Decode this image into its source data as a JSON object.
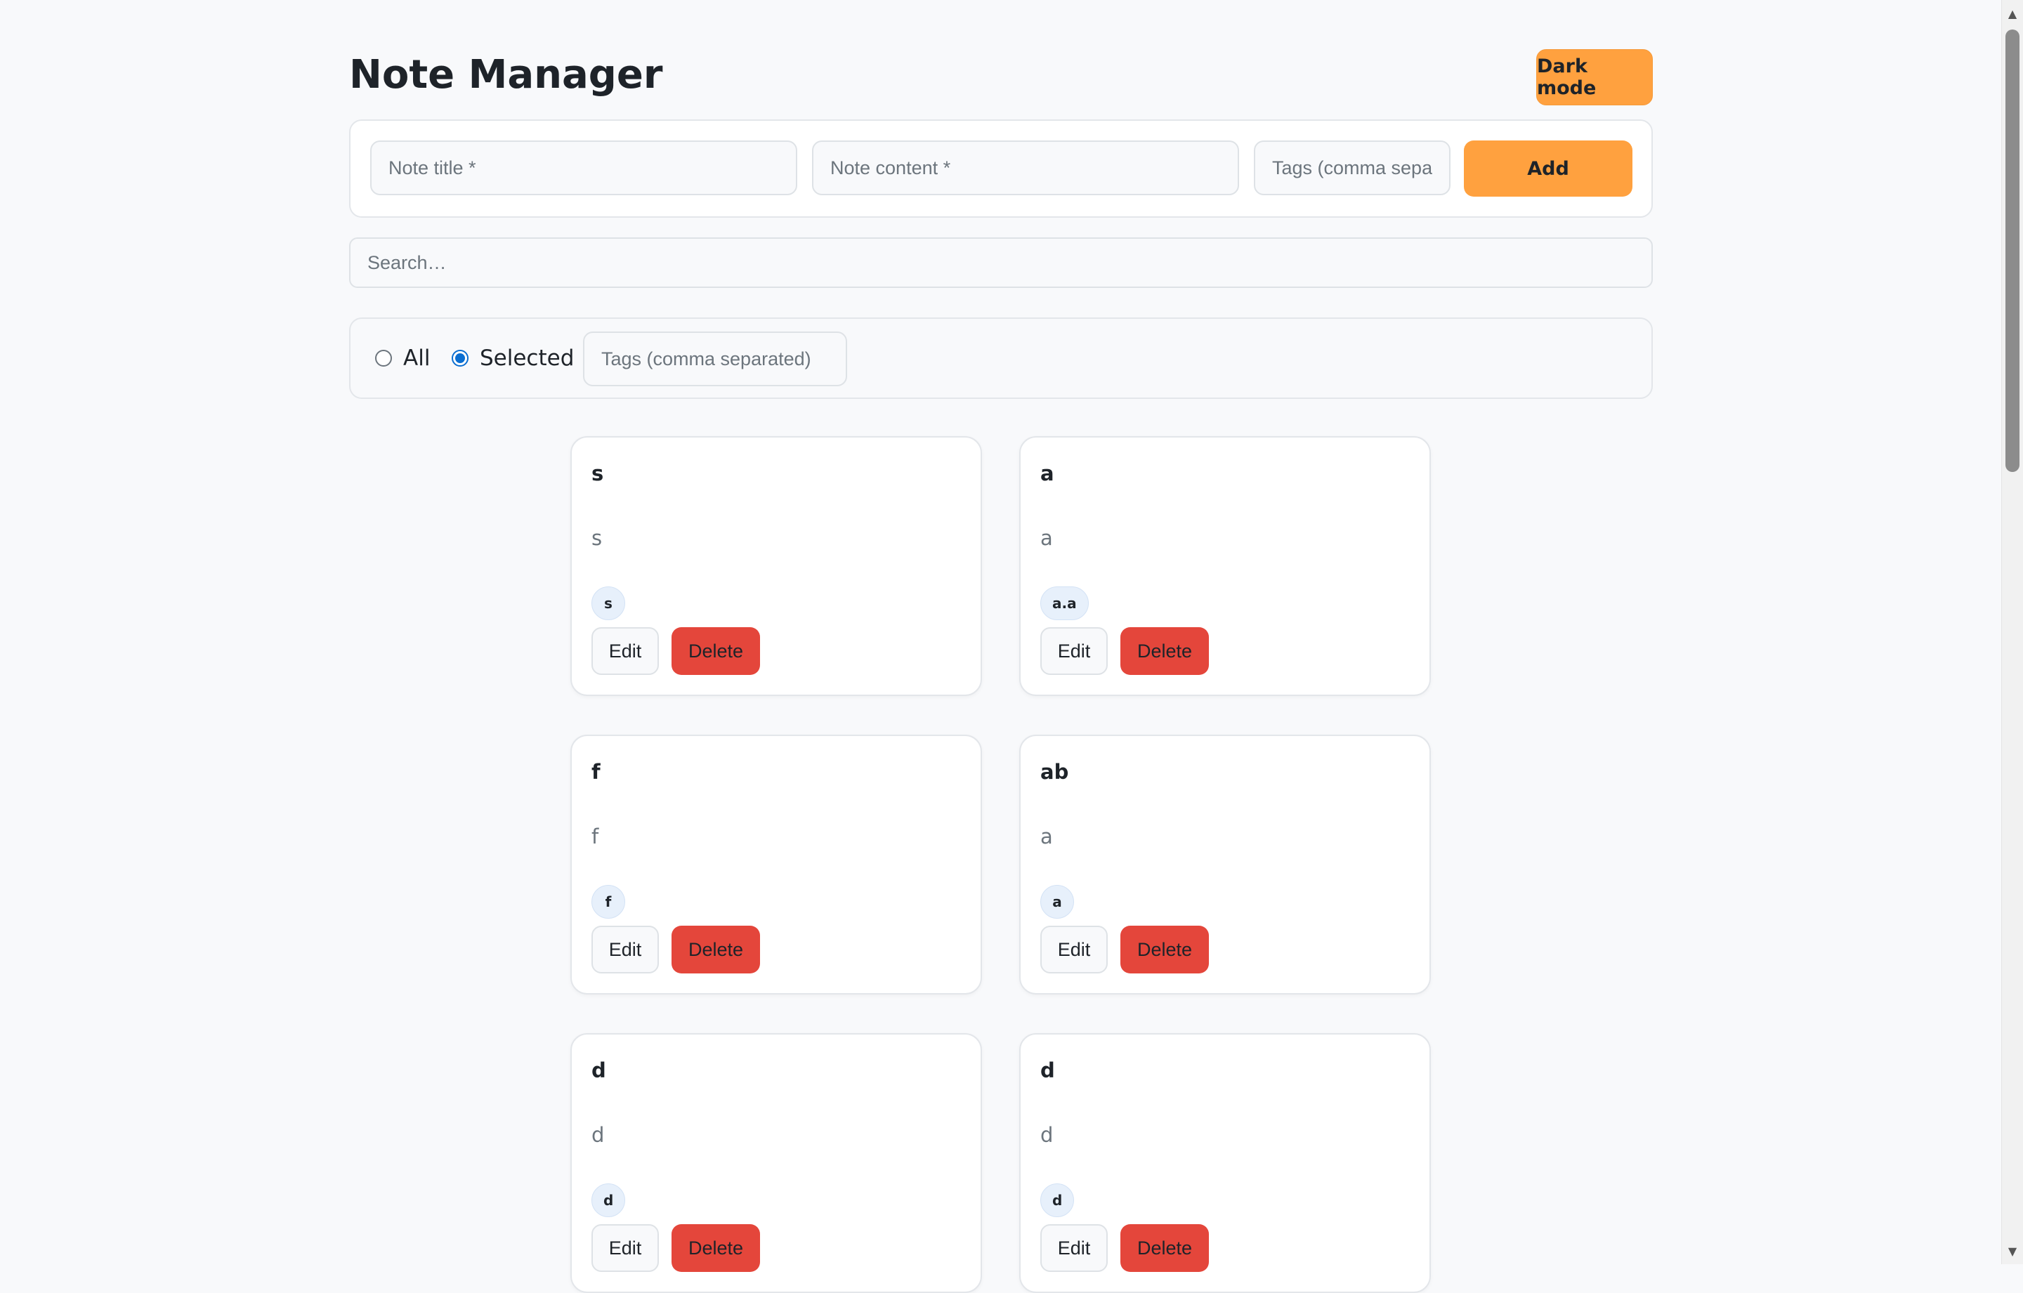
{
  "header": {
    "title": "Note Manager",
    "dark_mode_label": "Dark mode"
  },
  "add_form": {
    "title_placeholder": "Note title *",
    "content_placeholder": "Note content *",
    "tags_placeholder": "Tags (comma separated)",
    "add_label": "Add"
  },
  "search": {
    "placeholder": "Search…"
  },
  "filter": {
    "all_label": "All",
    "selected_label": "Selected",
    "selected_option": "Selected",
    "tags_placeholder": "Tags (comma separated)"
  },
  "notes": [
    {
      "title": "s",
      "content": "s",
      "tag": "s"
    },
    {
      "title": "a",
      "content": "a",
      "tag": "a.a"
    },
    {
      "title": "f",
      "content": "f",
      "tag": "f"
    },
    {
      "title": "ab",
      "content": "a",
      "tag": "a"
    },
    {
      "title": "d",
      "content": "d",
      "tag": "d"
    },
    {
      "title": "d",
      "content": "d",
      "tag": "d"
    }
  ],
  "note_actions": {
    "edit_label": "Edit",
    "delete_label": "Delete"
  },
  "colors": {
    "accent": "#ffa13f",
    "danger": "#e4463b",
    "tag_bg": "#e7f0fb",
    "radio_checked": "#0a6ed1"
  },
  "icons": {
    "scroll_up": "triangle-up-icon",
    "scroll_down": "triangle-down-icon"
  }
}
